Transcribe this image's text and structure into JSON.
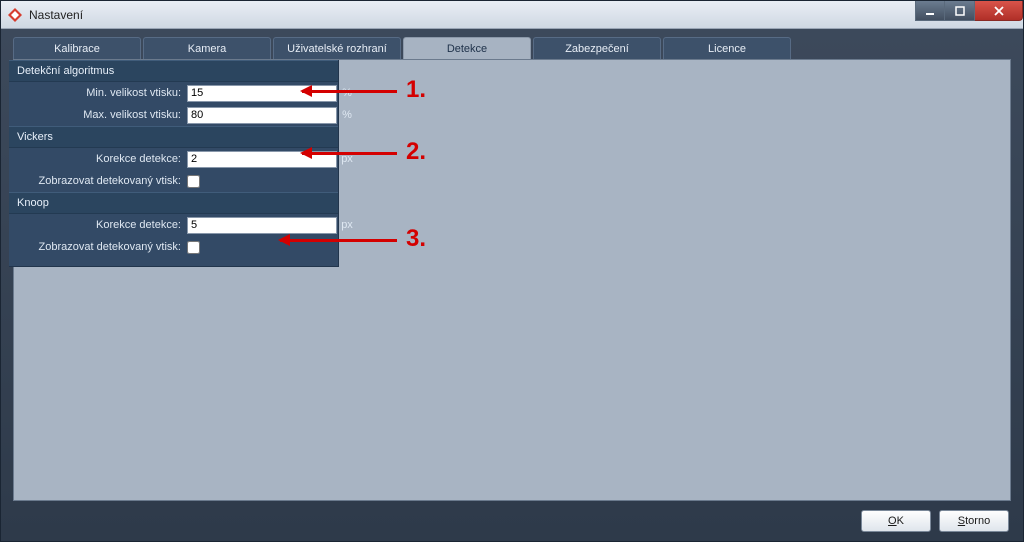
{
  "window": {
    "title": "Nastavení"
  },
  "tabs": [
    {
      "label": "Kalibrace",
      "active": false
    },
    {
      "label": "Kamera",
      "active": false
    },
    {
      "label": "Uživatelské rozhraní",
      "active": false
    },
    {
      "label": "Detekce",
      "active": true
    },
    {
      "label": "Zabezpečení",
      "active": false
    },
    {
      "label": "Licence",
      "active": false
    }
  ],
  "sections": {
    "algo": {
      "title": "Detekční algoritmus",
      "min_label": "Min. velikost vtisku:",
      "min_value": "15",
      "min_unit": "%",
      "max_label": "Max. velikost vtisku:",
      "max_value": "80",
      "max_unit": "%"
    },
    "vickers": {
      "title": "Vickers",
      "corr_label": "Korekce detekce:",
      "corr_value": "2",
      "corr_unit": "px",
      "show_label": "Zobrazovat detekovaný vtisk:",
      "show_checked": false
    },
    "knoop": {
      "title": "Knoop",
      "corr_label": "Korekce detekce:",
      "corr_value": "5",
      "corr_unit": "px",
      "show_label": "Zobrazovat detekovaný vtisk:",
      "show_checked": false
    }
  },
  "footer": {
    "ok": "OK",
    "cancel": "Storno"
  },
  "annotations": {
    "a1": "1.",
    "a2": "2.",
    "a3": "3."
  }
}
